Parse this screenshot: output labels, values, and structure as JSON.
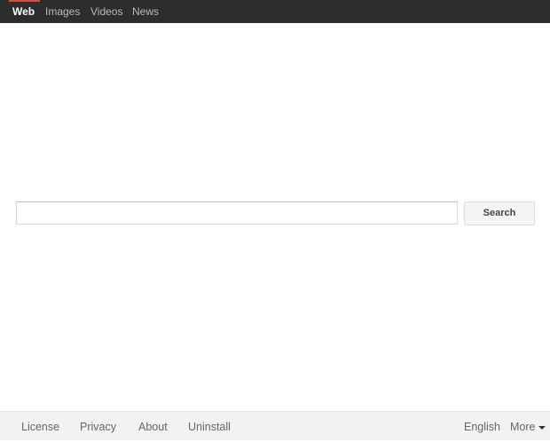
{
  "nav": {
    "items": [
      {
        "label": "Web",
        "active": true
      },
      {
        "label": "Images",
        "active": false
      },
      {
        "label": "Videos",
        "active": false
      },
      {
        "label": "News",
        "active": false
      }
    ]
  },
  "search": {
    "value": "",
    "placeholder": "",
    "button_label": "Search"
  },
  "footer": {
    "links": [
      "License",
      "Privacy",
      "About",
      "Uninstall"
    ],
    "language": "English",
    "more_label": "More"
  },
  "colors": {
    "topbar_bg": "#2d2d2d",
    "active_accent": "#dd4b39",
    "footer_bg": "#f2f2f2"
  }
}
